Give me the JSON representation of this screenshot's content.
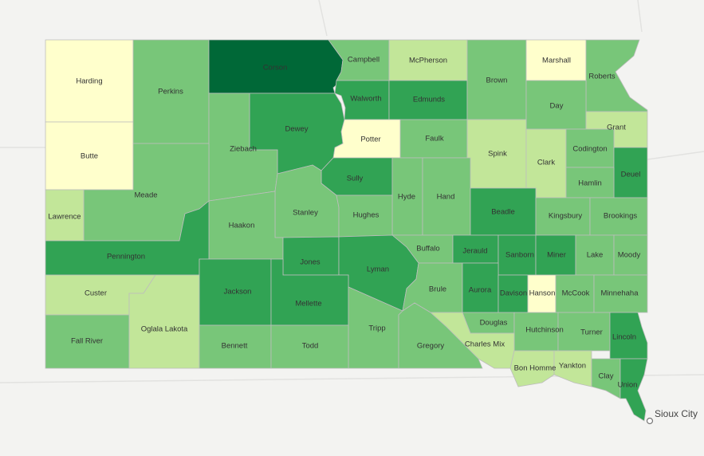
{
  "colors": [
    "#ffffcc",
    "#c2e699",
    "#78c679",
    "#31a354",
    "#006837"
  ],
  "city": {
    "name": "Sioux City"
  },
  "counties": [
    {
      "name": "Harding",
      "level": 0
    },
    {
      "name": "Butte",
      "level": 0
    },
    {
      "name": "Perkins",
      "level": 2
    },
    {
      "name": "Corson",
      "level": 4
    },
    {
      "name": "Campbell",
      "level": 2
    },
    {
      "name": "McPherson",
      "level": 1
    },
    {
      "name": "Walworth",
      "level": 3
    },
    {
      "name": "Edmunds",
      "level": 3
    },
    {
      "name": "Potter",
      "level": 0
    },
    {
      "name": "Faulk",
      "level": 2
    },
    {
      "name": "Brown",
      "level": 2
    },
    {
      "name": "Marshall",
      "level": 0
    },
    {
      "name": "Roberts",
      "level": 2
    },
    {
      "name": "Day",
      "level": 2
    },
    {
      "name": "Grant",
      "level": 1
    },
    {
      "name": "Dewey",
      "level": 3
    },
    {
      "name": "Ziebach",
      "level": 2
    },
    {
      "name": "Spink",
      "level": 1
    },
    {
      "name": "Clark",
      "level": 1
    },
    {
      "name": "Codington",
      "level": 2
    },
    {
      "name": "Deuel",
      "level": 3
    },
    {
      "name": "Hamlin",
      "level": 2
    },
    {
      "name": "Sully",
      "level": 3
    },
    {
      "name": "Meade",
      "level": 2
    },
    {
      "name": "Lawrence",
      "level": 1
    },
    {
      "name": "Hyde",
      "level": 2
    },
    {
      "name": "Hand",
      "level": 2
    },
    {
      "name": "Stanley",
      "level": 2
    },
    {
      "name": "Hughes",
      "level": 2
    },
    {
      "name": "Beadle",
      "level": 3
    },
    {
      "name": "Kingsbury",
      "level": 2
    },
    {
      "name": "Brookings",
      "level": 2
    },
    {
      "name": "Haakon",
      "level": 2
    },
    {
      "name": "Buffalo",
      "level": 2
    },
    {
      "name": "Jerauld",
      "level": 3
    },
    {
      "name": "Sanborn",
      "level": 3
    },
    {
      "name": "Miner",
      "level": 3
    },
    {
      "name": "Lake",
      "level": 2
    },
    {
      "name": "Moody",
      "level": 2
    },
    {
      "name": "Pennington",
      "level": 3
    },
    {
      "name": "Jones",
      "level": 3
    },
    {
      "name": "Lyman",
      "level": 3
    },
    {
      "name": "Brule",
      "level": 2
    },
    {
      "name": "Aurora",
      "level": 3
    },
    {
      "name": "Davison",
      "level": 3
    },
    {
      "name": "Hanson",
      "level": 0
    },
    {
      "name": "McCook",
      "level": 2
    },
    {
      "name": "Minnehaha",
      "level": 2
    },
    {
      "name": "Custer",
      "level": 1
    },
    {
      "name": "Jackson",
      "level": 3
    },
    {
      "name": "Mellette",
      "level": 3
    },
    {
      "name": "Douglas",
      "level": 2
    },
    {
      "name": "Hutchinson",
      "level": 2
    },
    {
      "name": "Turner",
      "level": 2
    },
    {
      "name": "Lincoln",
      "level": 3
    },
    {
      "name": "Tripp",
      "level": 2
    },
    {
      "name": "Fall River",
      "level": 2
    },
    {
      "name": "Oglala Lakota",
      "level": 1
    },
    {
      "name": "Charles Mix",
      "level": 1
    },
    {
      "name": "Gregory",
      "level": 2
    },
    {
      "name": "Bennett",
      "level": 2
    },
    {
      "name": "Todd",
      "level": 2
    },
    {
      "name": "Bon Homme",
      "level": 1
    },
    {
      "name": "Yankton",
      "level": 1
    },
    {
      "name": "Clay",
      "level": 2
    },
    {
      "name": "Union",
      "level": 3
    }
  ]
}
